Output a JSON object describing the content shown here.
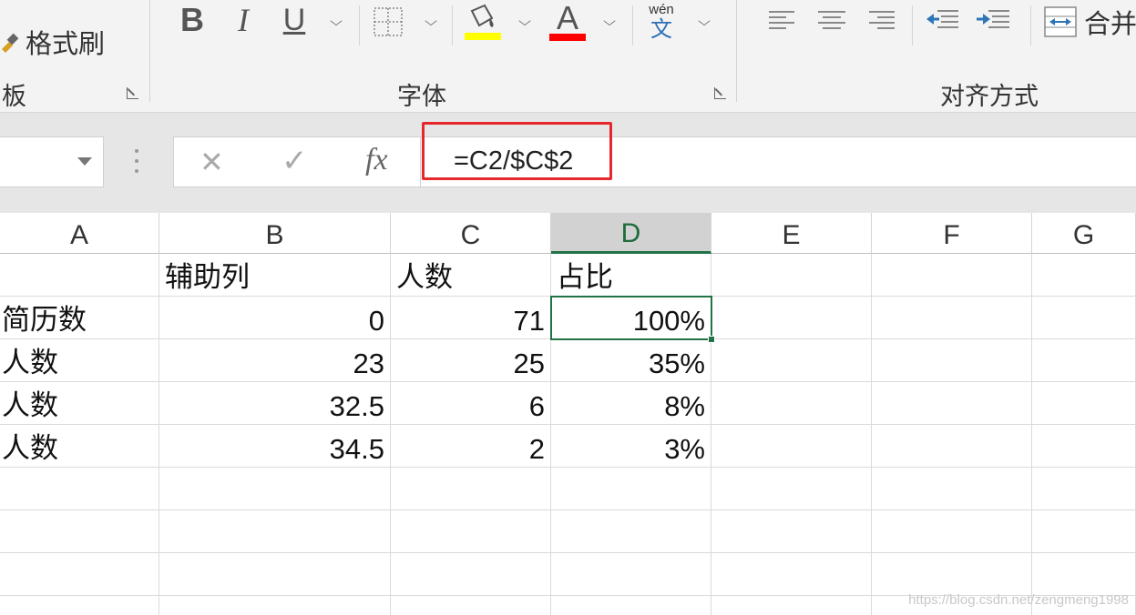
{
  "ribbon": {
    "clipboard": {
      "format_painter_label": "格式刷",
      "group_label_partial": "板"
    },
    "font": {
      "bold_label": "B",
      "italic_label": "I",
      "underline_label": "U",
      "font_color_label": "A",
      "wen_top": "wén",
      "wen_bottom": "文",
      "group_label": "字体",
      "fill_color": "#ffff00",
      "font_color": "#ff0000"
    },
    "alignment": {
      "merge_label_partial": "合并",
      "group_label": "对齐方式"
    }
  },
  "formula_bar": {
    "cancel_icon": "✕",
    "enter_icon": "✓",
    "fx_label": "fx",
    "formula": "=C2/$C$2",
    "highlight_color": "#e4282c"
  },
  "sheet": {
    "columns": [
      "A",
      "B",
      "C",
      "D",
      "E",
      "F",
      "G"
    ],
    "selected_column": "D",
    "rows": [
      {
        "a": "",
        "b": "辅助列",
        "c": "人数",
        "d": "占比"
      },
      {
        "a": "简历数",
        "b": "0",
        "c": "71",
        "d": "100%"
      },
      {
        "a": "人数",
        "b": "23",
        "c": "25",
        "d": "35%"
      },
      {
        "a": "人数",
        "b": "32.5",
        "c": "6",
        "d": "8%"
      },
      {
        "a": "人数",
        "b": "34.5",
        "c": "2",
        "d": "3%"
      }
    ],
    "active_cell": "D2",
    "accent_color": "#217346"
  },
  "watermark": "https://blog.csdn.net/zengmeng1998"
}
